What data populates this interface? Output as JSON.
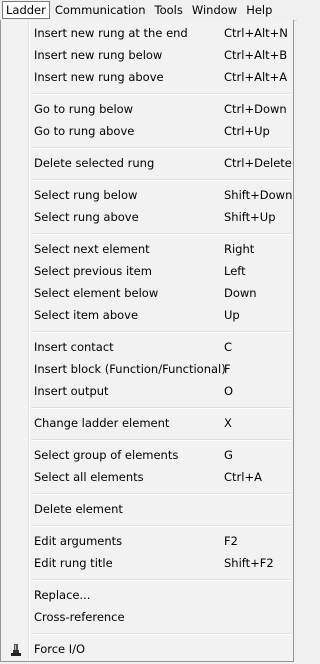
{
  "menubar": {
    "items": [
      {
        "label": "Ladder"
      },
      {
        "label": "Communication"
      },
      {
        "label": "Tools"
      },
      {
        "label": "Window"
      },
      {
        "label": "Help"
      }
    ]
  },
  "menu": {
    "items": [
      {
        "label": "Insert new rung at the end",
        "shortcut": "Ctrl+Alt+N"
      },
      {
        "label": "Insert new rung below",
        "shortcut": "Ctrl+Alt+B"
      },
      {
        "label": "Insert new rung above",
        "shortcut": "Ctrl+Alt+A"
      },
      {
        "label": "Go to rung below",
        "shortcut": "Ctrl+Down"
      },
      {
        "label": "Go to rung above",
        "shortcut": "Ctrl+Up"
      },
      {
        "label": "Delete selected rung",
        "shortcut": "Ctrl+Delete"
      },
      {
        "label": "Select rung below",
        "shortcut": "Shift+Down"
      },
      {
        "label": "Select rung above",
        "shortcut": "Shift+Up"
      },
      {
        "label": "Select next element",
        "shortcut": "Right"
      },
      {
        "label": "Select previous item",
        "shortcut": "Left"
      },
      {
        "label": "Select element below",
        "shortcut": "Down"
      },
      {
        "label": "Select item above",
        "shortcut": "Up"
      },
      {
        "label": "Insert contact",
        "shortcut": "C"
      },
      {
        "label": "Insert block (Function/Functional)",
        "shortcut": "F"
      },
      {
        "label": "Insert output",
        "shortcut": "O"
      },
      {
        "label": "Change ladder element",
        "shortcut": "X"
      },
      {
        "label": "Select group of elements",
        "shortcut": "G"
      },
      {
        "label": "Select all elements",
        "shortcut": "Ctrl+A"
      },
      {
        "label": "Delete element",
        "shortcut": ""
      },
      {
        "label": "Edit arguments",
        "shortcut": "F2"
      },
      {
        "label": "Edit rung title",
        "shortcut": "Shift+F2"
      },
      {
        "label": "Replace...",
        "shortcut": ""
      },
      {
        "label": "Cross-reference",
        "shortcut": ""
      },
      {
        "label": "Force I/O",
        "shortcut": "",
        "icon": "force-io-icon"
      }
    ]
  }
}
